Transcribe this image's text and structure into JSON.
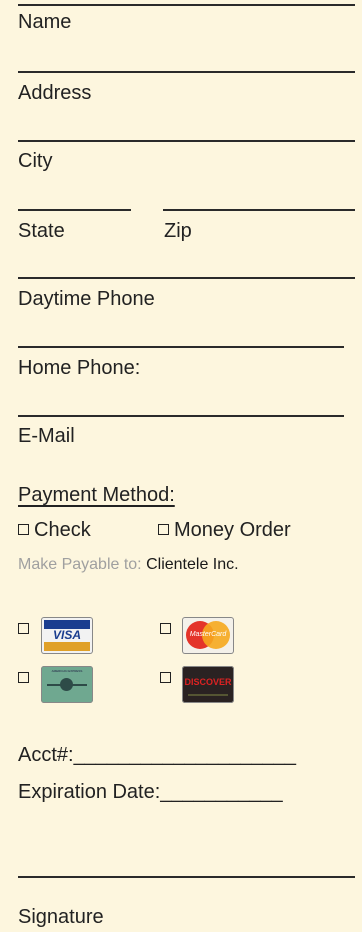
{
  "form": {
    "fields": {
      "name": "Name",
      "address": "Address",
      "city": "City",
      "state": "State",
      "zip": "Zip",
      "daytime_phone": "Daytime Phone",
      "home_phone": "Home Phone:",
      "email": "E-Mail"
    },
    "payment": {
      "heading": "Payment Method:",
      "options": [
        "Check",
        "Money Order"
      ],
      "payable_prefix": "Make Payable to:",
      "payable_name": "Clientele Inc.",
      "cards": {
        "visa": "VISA",
        "mastercard": "MasterCard",
        "amex": "AMERICAN EXPRESS",
        "discover": "DISCOVER"
      }
    },
    "account": {
      "acct_label": "Acct#:",
      "acct_line": "____________________",
      "exp_label": "Expiration Date:",
      "exp_line": "___________",
      "signature": "Signature"
    }
  }
}
